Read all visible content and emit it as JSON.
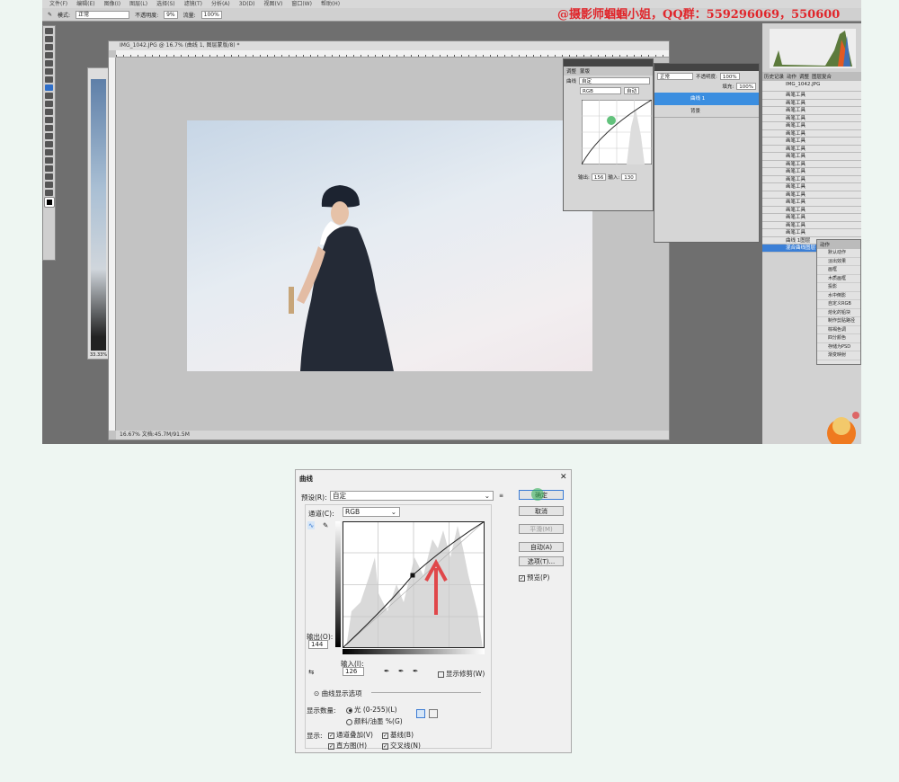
{
  "photoshop": {
    "menu": [
      "文件(F)",
      "编辑(E)",
      "图像(I)",
      "图层(L)",
      "选择(S)",
      "滤镜(T)",
      "分析(A)",
      "3D(D)",
      "视图(V)",
      "窗口(W)",
      "帮助(H)"
    ],
    "options": {
      "mode_label": "模式:",
      "mode_value": "正常",
      "opacity_label": "不透明度:",
      "opacity_value": "9%",
      "flow_label": "流量:",
      "flow_value": "100%"
    },
    "watermark": "@摄影师蝈蝈小姐，QQ群：559296069，550600",
    "document": {
      "title": "IMG_1042.JPG @ 16.7% (曲线 1, 图层蒙版/8) *",
      "status": "16.67%   文档:45.7M/91.5M"
    },
    "side_doc_zoom": "33.33%",
    "adjust_panel": {
      "tabs": [
        "调整",
        "蒙版"
      ],
      "preset_label": "曲线",
      "preset_value": "自定",
      "channel": "RGB",
      "auto": "自动",
      "output_label": "输出:",
      "output_value": "156",
      "input_label": "输入:",
      "input_value": "130"
    },
    "layers_panel": {
      "blend": "正常",
      "opacity_label": "不透明度:",
      "opacity_value": "100%",
      "fill_label": "填充:",
      "fill_value": "100%",
      "layers": [
        "曲线 1",
        "背景"
      ]
    },
    "history_panel": {
      "tabs": [
        "历史记录",
        "动作",
        "调整",
        "图层复合"
      ],
      "snapshot": "IMG_1042.JPG",
      "items": [
        "画笔工具",
        "画笔工具",
        "画笔工具",
        "画笔工具",
        "画笔工具",
        "画笔工具",
        "画笔工具",
        "画笔工具",
        "画笔工具",
        "画笔工具",
        "画笔工具",
        "画笔工具",
        "画笔工具",
        "画笔工具",
        "画笔工具",
        "画笔工具",
        "画笔工具",
        "画笔工具",
        "画笔工具"
      ],
      "after": "曲线 1图层",
      "selected": "混合曲线图层"
    },
    "actions_panel": {
      "tab": "动作",
      "items": [
        "默认动作",
        "淡出效果",
        "画框",
        "木质画框",
        "投影",
        "水中倒影",
        "自定义RGB",
        "熔化的铅块",
        "制作剪贴路径",
        "棕褐色调",
        "四分颜色",
        "存储为PSD",
        "渐变映射"
      ]
    }
  },
  "dialog": {
    "title": "曲线",
    "close": "✕",
    "preset_label": "预设(R):",
    "preset_value": "自定",
    "channel_label": "通道(C):",
    "channel_value": "RGB",
    "buttons": {
      "ok": "确定",
      "cancel": "取消",
      "smooth": "平滑(M)",
      "auto": "自动(A)",
      "options": "选项(T)..."
    },
    "preview": "预览(P)",
    "output_label": "输出(O):",
    "output_value": "144",
    "input_label": "输入(I):",
    "input_value": "126",
    "show_clipping": "显示修剪(W)",
    "display_options": "曲线显示选项",
    "show_amount_label": "显示数量:",
    "amount_light": "光 (0-255)(L)",
    "amount_pigment": "颜料/油墨 %(G)",
    "show_label": "显示:",
    "show_items": [
      "通道叠加(V)",
      "基线(B)",
      "直方图(H)",
      "交叉线(N)"
    ]
  }
}
